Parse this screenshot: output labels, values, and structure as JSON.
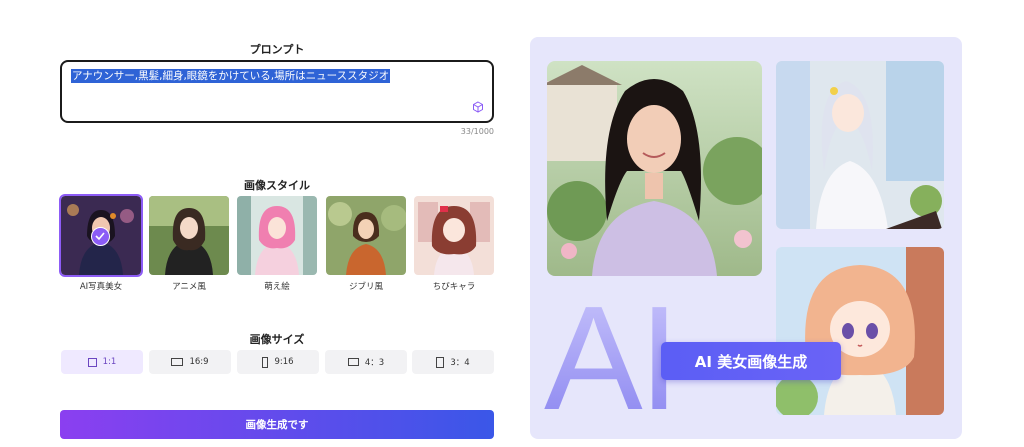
{
  "prompt": {
    "title": "プロンプト",
    "value": "アナウンサー,黒髪,細身,眼鏡をかけている,場所はニューススタジオ",
    "counter": "33/1000",
    "dice_icon": "dice-icon"
  },
  "styles": {
    "title": "画像スタイル",
    "items": [
      {
        "label": "AI写真美女",
        "selected": true
      },
      {
        "label": "アニメ風",
        "selected": false
      },
      {
        "label": "萌え絵",
        "selected": false
      },
      {
        "label": "ジブリ風",
        "selected": false
      },
      {
        "label": "ちびキャラ",
        "selected": false
      }
    ]
  },
  "sizes": {
    "title": "画像サイズ",
    "options": [
      {
        "label": "1:1",
        "active": true
      },
      {
        "label": "16:9",
        "active": false
      },
      {
        "label": "9:16",
        "active": false
      },
      {
        "label": "4：3",
        "active": false
      },
      {
        "label": "3：4",
        "active": false
      }
    ]
  },
  "generate": {
    "label": "画像生成です"
  },
  "showcase": {
    "big_text": "AI",
    "badge": "AI 美女画像生成"
  },
  "colors": {
    "accent": "#8b5cf6",
    "gradient_start": "#8b3ff0",
    "gradient_end": "#3a57e8",
    "panel_bg": "#e6e6fb"
  }
}
